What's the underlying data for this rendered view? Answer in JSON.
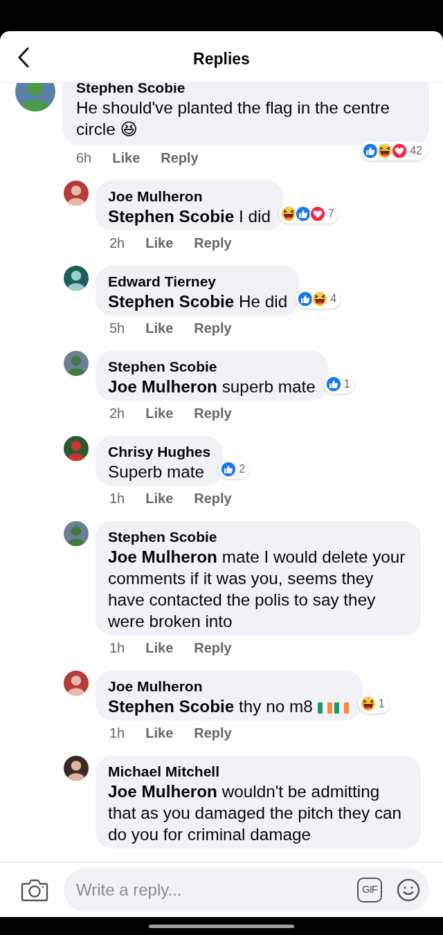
{
  "header": {
    "title": "Replies"
  },
  "comments": [
    {
      "kind": "comment",
      "author": "Stephen Scobie",
      "body": "He should've planted the flag in the centre circle 😆",
      "time": "6h",
      "like": "Like",
      "reply": "Reply",
      "reactions": {
        "types": [
          {
            "kind": "like"
          },
          {
            "kind": "laugh"
          },
          {
            "kind": "love"
          }
        ],
        "count": "42"
      }
    },
    {
      "kind": "reply",
      "author": "Joe Mulheron",
      "body": "**Stephen Scobie** I did",
      "time": "2h",
      "like": "Like",
      "reply": "Reply",
      "reactions": {
        "types": [
          {
            "kind": "laugh"
          },
          {
            "kind": "like"
          },
          {
            "kind": "love"
          }
        ],
        "count": "7"
      }
    },
    {
      "kind": "reply",
      "author": "Edward Tierney",
      "body": "**Stephen Scobie** He did",
      "time": "5h",
      "like": "Like",
      "reply": "Reply",
      "reactions": {
        "types": [
          {
            "kind": "like"
          },
          {
            "kind": "laugh"
          }
        ],
        "count": "4"
      }
    },
    {
      "kind": "reply",
      "author": "Stephen Scobie",
      "body": "**Joe Mulheron** superb mate",
      "time": "2h",
      "like": "Like",
      "reply": "Reply",
      "reactions": {
        "types": [
          {
            "kind": "like"
          }
        ],
        "count": "1"
      }
    },
    {
      "kind": "reply",
      "author": "Chrisy Hughes",
      "body": "Superb mate",
      "time": "1h",
      "like": "Like",
      "reply": "Reply",
      "reactions": {
        "types": [
          {
            "kind": "like"
          }
        ],
        "count": "2"
      }
    },
    {
      "kind": "reply",
      "author": "Stephen Scobie",
      "body": "**Joe Mulheron** mate I would delete your comments if it was you, seems they have contacted the polis to say they were broken into",
      "time": "1h",
      "like": "Like",
      "reply": "Reply"
    },
    {
      "kind": "reply",
      "author": "Joe Mulheron",
      "body": "**Stephen Scobie** thy no m8",
      "emoji": [
        {
          "kind": "flag"
        },
        {
          "kind": "flag"
        }
      ],
      "time": "1h",
      "like": "Like",
      "reply": "Reply",
      "reactions": {
        "types": [
          {
            "kind": "laugh"
          }
        ],
        "count": "1"
      }
    },
    {
      "kind": "reply",
      "author": "Michael Mitchell",
      "body": "**Joe Mulheron** wouldn't be admitting that as you damaged the pitch they can do you for criminal damage"
    }
  ],
  "composer": {
    "placeholder": "Write a reply...",
    "gif_label": "GIF"
  }
}
